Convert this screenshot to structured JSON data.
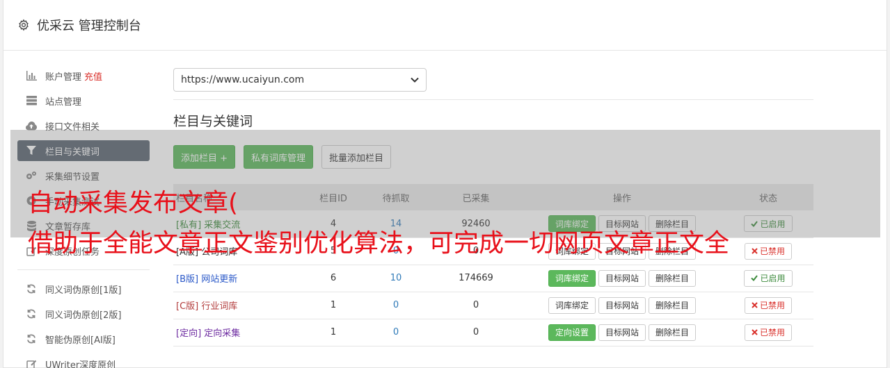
{
  "header": {
    "title": "优采云 管理控制台",
    "icon": "gear-icon"
  },
  "sidebar": {
    "items": [
      {
        "label": "账户管理",
        "extra": "充值",
        "icon": "bar-chart-icon"
      },
      {
        "label": "站点管理",
        "icon": "server-icon"
      },
      {
        "label": "接口文件相关",
        "icon": "cloud-upload-icon"
      },
      {
        "label": "栏目与关键词",
        "icon": "filter-icon",
        "active": true
      },
      {
        "label": "采集细节设置",
        "icon": "cogs-icon"
      },
      {
        "label": "手动采集测试",
        "icon": "record-icon"
      },
      {
        "label": "文章暂存库",
        "icon": "database-icon"
      },
      {
        "label": "深度原创任务",
        "icon": "edit-icon"
      }
    ],
    "items2": [
      {
        "label": "同义词伪原创[1版]",
        "icon": "refresh-icon"
      },
      {
        "label": "同义词伪原创[2版]",
        "icon": "refresh-icon"
      },
      {
        "label": "智能伪原创[AI版]",
        "icon": "refresh-icon"
      },
      {
        "label": "UWriter深度原创",
        "icon": "edit-icon"
      }
    ]
  },
  "main": {
    "site_select": "https://www.ucaiyun.com",
    "section_title": "栏目与关键词",
    "buttons": {
      "add": "添加栏目 +",
      "private": "私有词库管理",
      "batch": "批量添加栏目"
    },
    "table": {
      "headers": [
        "栏目名称",
        "栏目ID",
        "待抓取",
        "已采集",
        "操作",
        "状态"
      ],
      "rows": [
        {
          "tag": "[私有]",
          "name": "采集交流",
          "tag_class": "tag-private",
          "id": "4",
          "pending": "14",
          "collected": "92460",
          "op1": "词库绑定",
          "op1_green": true,
          "op2": "目标网站",
          "op3": "删除栏目",
          "status": "已启用",
          "status_on": true
        },
        {
          "tag": "[A版]",
          "name": "公司词库",
          "tag_class": "tag-a",
          "id": "5",
          "pending": "0",
          "collected": "0",
          "op1": "词库绑定",
          "op1_green": false,
          "op2": "目标网站",
          "op3": "删除栏目",
          "status": "已禁用",
          "status_on": false
        },
        {
          "tag": "[B版]",
          "name": "网站更新",
          "tag_class": "tag-b",
          "id": "6",
          "pending": "10",
          "collected": "174669",
          "op1": "词库绑定",
          "op1_green": true,
          "op2": "目标网站",
          "op3": "删除栏目",
          "status": "已启用",
          "status_on": true
        },
        {
          "tag": "[C版]",
          "name": "行业词库",
          "tag_class": "tag-c",
          "id": "1",
          "pending": "0",
          "collected": "0",
          "op1": "词库绑定",
          "op1_green": false,
          "op2": "目标网站",
          "op3": "删除栏目",
          "status": "已禁用",
          "status_on": false
        },
        {
          "tag": "[定向]",
          "name": "定向采集",
          "tag_class": "tag-d",
          "id": "1",
          "pending": "0",
          "collected": "0",
          "op1": "定向设置",
          "op1_green": true,
          "op2": "目标网站",
          "op3": "删除栏目",
          "status": "已禁用",
          "status_on": false
        }
      ]
    }
  },
  "overlay": {
    "line1": "自动采集发布文章(",
    "line2": "借助于全能文章正文鉴别优化算法，可完成一切网页文章正文全"
  },
  "colors": {
    "accent_green": "#5cb85c",
    "active_sidebar": "#5a6470",
    "overlay_text": "#e8101a"
  }
}
